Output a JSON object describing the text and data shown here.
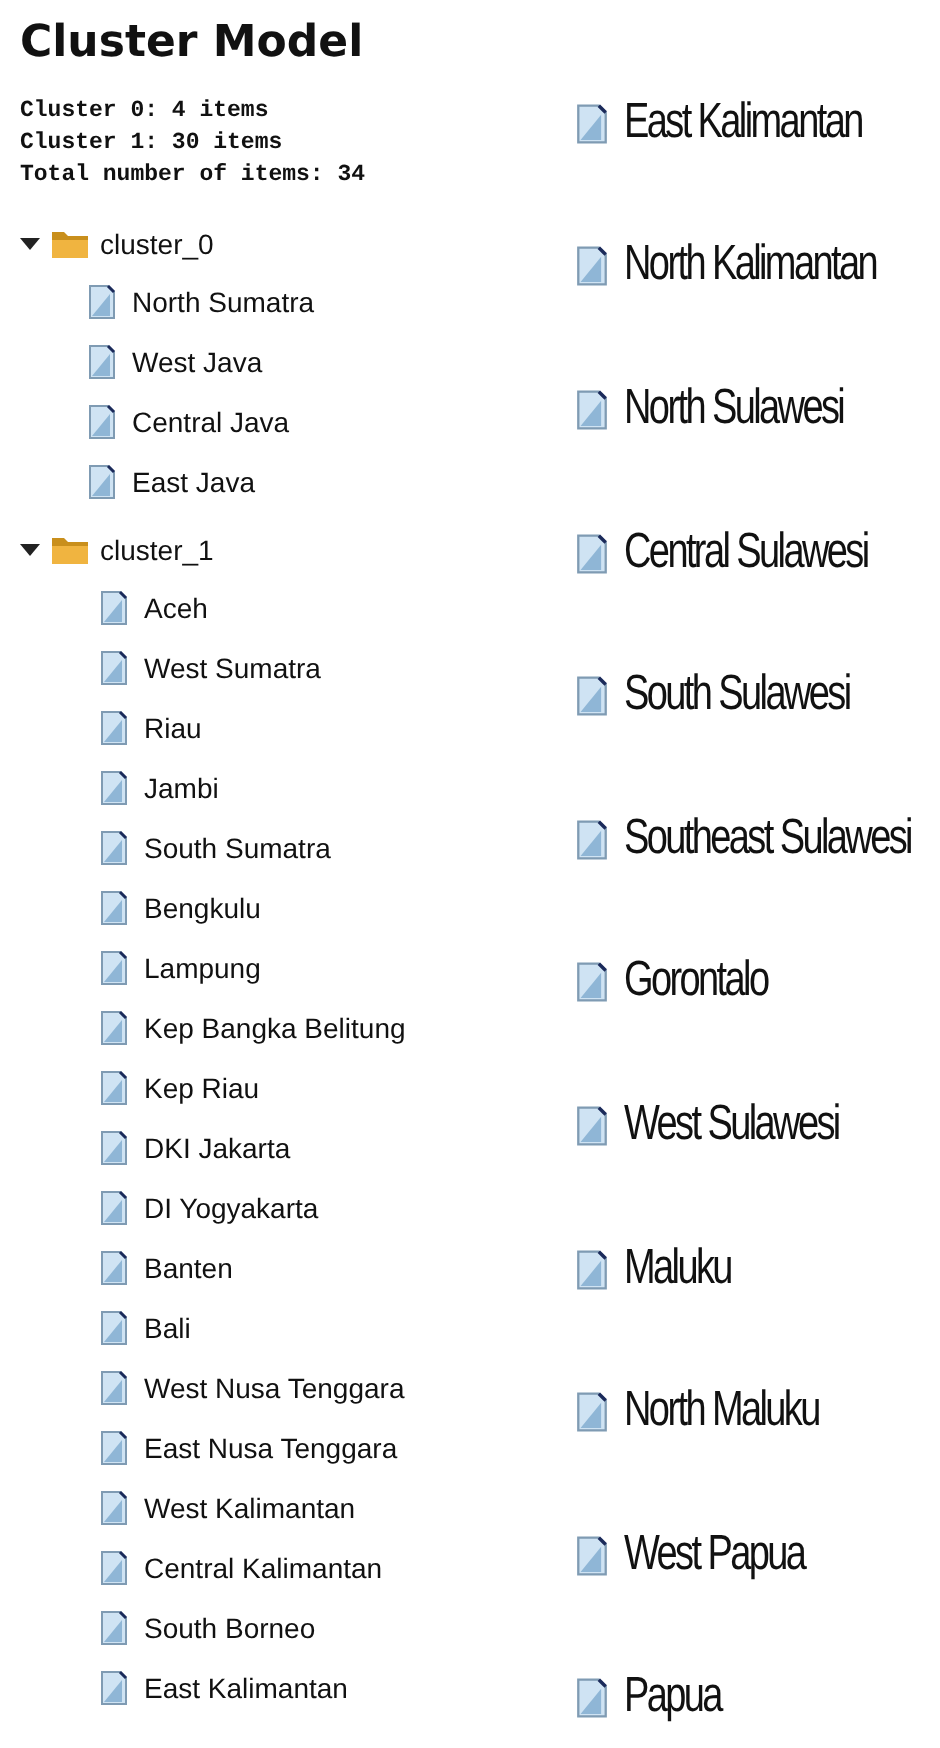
{
  "title": "Cluster Model",
  "summary": [
    "Cluster 0: 4 items",
    "Cluster 1: 30 items",
    "Total number of items: 34"
  ],
  "clusters": [
    {
      "label": "cluster_0",
      "expanded": true,
      "items": [
        "North Sumatra",
        "West Java",
        "Central Java",
        "East Java"
      ]
    },
    {
      "label": "cluster_1",
      "expanded": true,
      "items": [
        "Aceh",
        "West Sumatra",
        "Riau",
        "Jambi",
        "South Sumatra",
        "Bengkulu",
        "Lampung",
        "Kep Bangka Belitung",
        "Kep Riau",
        "DKI Jakarta",
        "DI Yogyakarta",
        "Banten",
        "Bali",
        "West Nusa Tenggara",
        "East Nusa Tenggara",
        "West Kalimantan",
        "Central Kalimantan",
        "South Borneo",
        "East Kalimantan"
      ]
    }
  ],
  "continued_items": [
    "East Kalimantan",
    "North Kalimantan",
    "North Sulawesi",
    "Central Sulawesi",
    "South Sulawesi",
    "Southeast Sulawesi",
    "Gorontalo",
    "West Sulawesi",
    "Maluku",
    "North Maluku",
    "West Papua",
    "Papua"
  ]
}
